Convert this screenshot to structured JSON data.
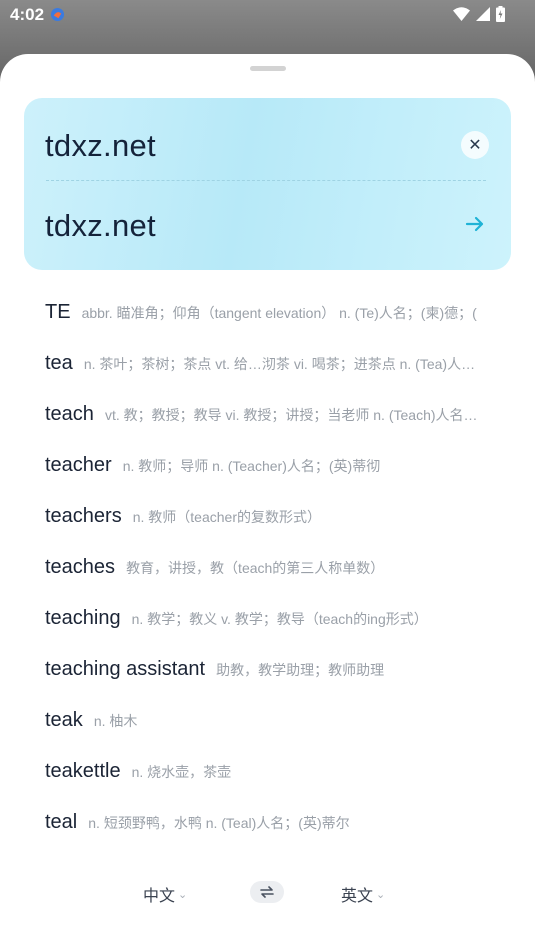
{
  "status_bar": {
    "time": "4:02"
  },
  "card": {
    "source_text": "tdxz.net",
    "result_text": "tdxz.net",
    "clear_glyph": "✕",
    "accent_color": "#1fb3d6"
  },
  "suggestions": [
    {
      "word": "TE",
      "definition": "abbr. 瞄准角；仰角（tangent elevation） n. (Te)人名；(柬)德；("
    },
    {
      "word": "tea",
      "definition": "n. 茶叶；茶树；茶点 vt. 给…沏茶 vi. 喝茶；进茶点 n. (Tea)人…"
    },
    {
      "word": "teach",
      "definition": "vt. 教；教授；教导 vi. 教授；讲授；当老师 n. (Teach)人名…"
    },
    {
      "word": "teacher",
      "definition": "n. 教师；导师 n. (Teacher)人名；(英)蒂彻"
    },
    {
      "word": "teachers",
      "definition": "n. 教师（teacher的复数形式）"
    },
    {
      "word": "teaches",
      "definition": "教育，讲授，教（teach的第三人称单数）"
    },
    {
      "word": "teaching",
      "definition": "n. 教学；教义 v. 教学；教导（teach的ing形式）"
    },
    {
      "word": "teaching assistant",
      "definition": "助教，教学助理；教师助理"
    },
    {
      "word": "teak",
      "definition": "n. 柚木"
    },
    {
      "word": "teakettle",
      "definition": "n. 烧水壶，茶壶"
    },
    {
      "word": "teal",
      "definition": "n. 短颈野鸭，水鸭 n. (Teal)人名；(英)蒂尔"
    }
  ],
  "language_bar": {
    "source_lang": "中文",
    "target_lang": "英文",
    "chevron": "⌄",
    "swap_glyph": "⇌"
  }
}
